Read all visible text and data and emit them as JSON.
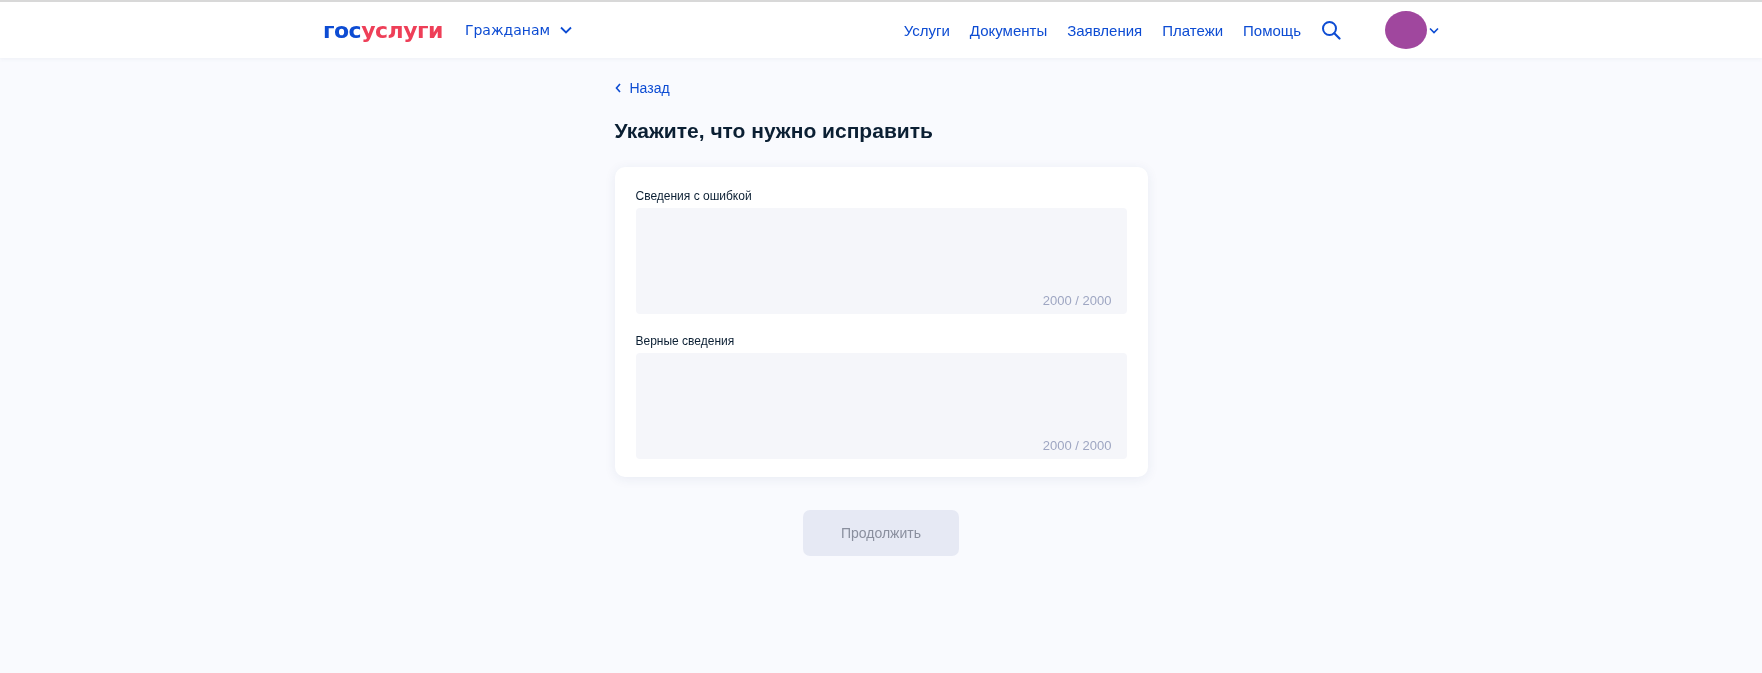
{
  "header": {
    "logo": {
      "prefix": "гос",
      "suffix": "услуги"
    },
    "audience_menu": {
      "label": "Гражданам",
      "expanded": false
    },
    "nav": [
      "Услуги",
      "Документы",
      "Заявления",
      "Платежи",
      "Помощь"
    ]
  },
  "back_link": "Назад",
  "title": "Укажите, что нужно исправить",
  "fields": [
    {
      "label": "Сведения с ошибкой",
      "counter": "2000 / 2000"
    },
    {
      "label": "Верные сведения",
      "counter": "2000 / 2000"
    }
  ],
  "continue_button": {
    "label": "Продолжить",
    "disabled": true
  }
}
